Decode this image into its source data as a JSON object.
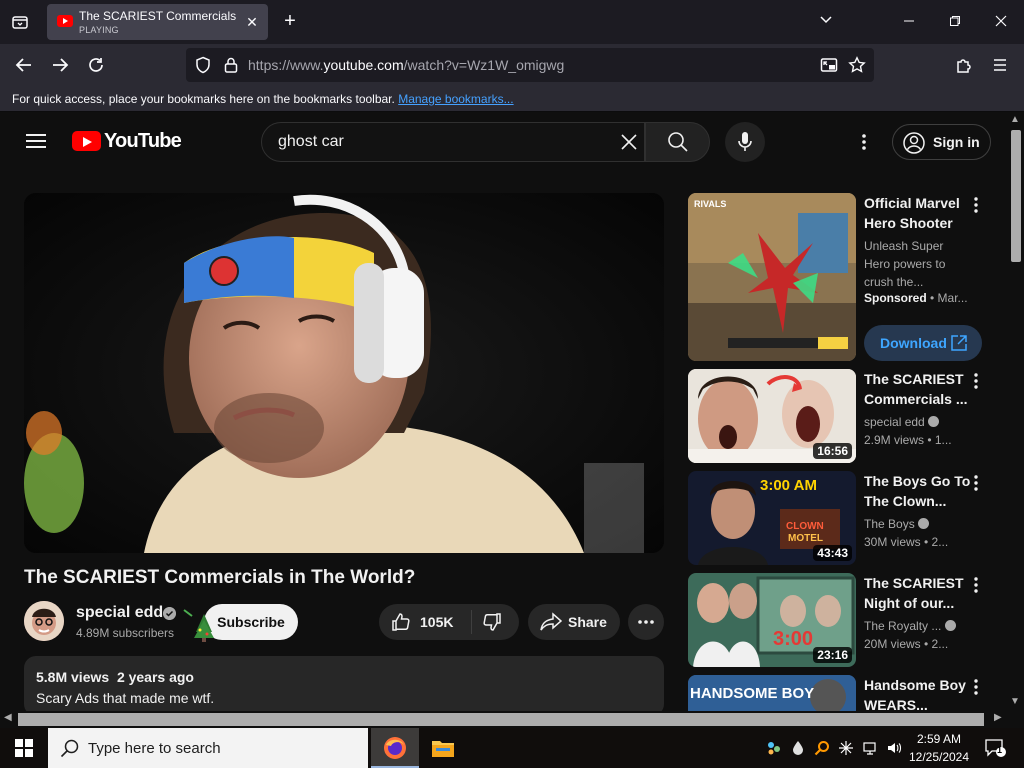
{
  "browser": {
    "tab": {
      "title": "The SCARIEST Commercials in",
      "status": "PLAYING"
    },
    "url": {
      "prefix": "https://www.",
      "domain": "youtube.com",
      "path": "/watch?v=Wz1W_omigwg"
    },
    "bookmarks_hint": "For quick access, place your bookmarks here on the bookmarks toolbar.",
    "bookmarks_link": "Manage bookmarks..."
  },
  "youtube": {
    "logo_text": "YouTube",
    "search_query": "ghost car",
    "signin_label": "Sign in"
  },
  "video": {
    "title": "The SCARIEST Commercials in The World?",
    "channel": "special edd",
    "subscribers": "4.89M subscribers",
    "subscribe_label": "Subscribe",
    "likes": "105K",
    "share_label": "Share",
    "views": "5.8M views",
    "age": "2 years ago",
    "description": "Scary Ads that made me wtf."
  },
  "sidebar": {
    "ad": {
      "title_line1": "Official Marvel",
      "title_line2": "Hero Shooter",
      "desc_line1": "Unleash Super",
      "desc_line2": "Hero powers to",
      "desc_line3": "crush the...",
      "sponsored": "Sponsored",
      "advertiser": " • Mar...",
      "download_label": "Download"
    },
    "items": [
      {
        "title_line1": "The SCARIEST",
        "title_line2": "Commercials ...",
        "channel": "special edd",
        "meta": "2.9M views  • 1...",
        "duration": "16:56"
      },
      {
        "title_line1": "The Boys Go To",
        "title_line2": "The Clown...",
        "channel": "The Boys",
        "meta": "30M views  • 2...",
        "duration": "43:43"
      },
      {
        "title_line1": "The SCARIEST",
        "title_line2": "Night of our...",
        "channel": "The Royalty ...",
        "meta": "20M views  • 2...",
        "duration": "23:16"
      },
      {
        "title_line1": "Handsome Boy",
        "title_line2": "WEARS...",
        "thumb_text": "HANDSOME BOY"
      }
    ]
  },
  "taskbar": {
    "search_placeholder": "Type here to search",
    "time": "2:59 AM",
    "date": "12/25/2024",
    "notifications": "1"
  }
}
